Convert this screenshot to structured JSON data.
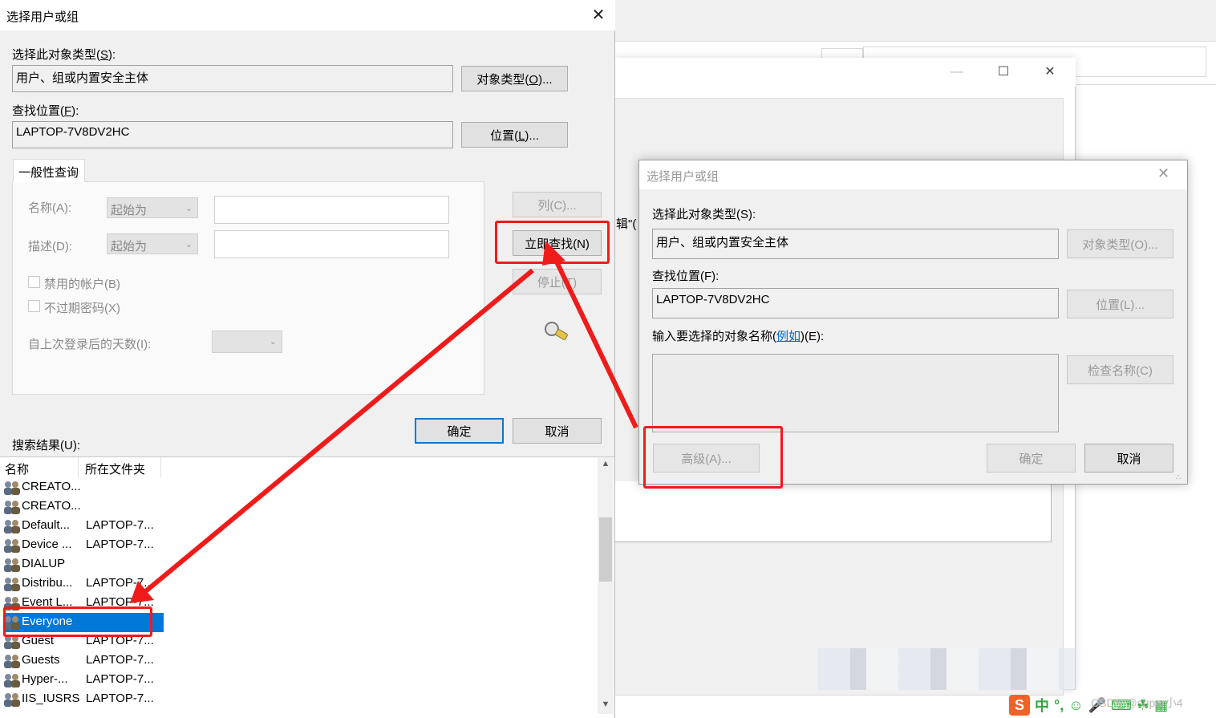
{
  "background_window": {
    "edit_fragment": "辑\"(",
    "minimize": "—",
    "maximize": "☐",
    "close": "✕"
  },
  "dialog_main": {
    "title": "选择用户或组",
    "close": "✕",
    "object_type_label": "选择此对象类型(",
    "object_type_key": "S",
    "object_type_suffix": "):",
    "object_type_value": "用户、组或内置安全主体",
    "object_types_button": "对象类型(",
    "object_types_key": "O",
    "object_types_suffix": ")...",
    "location_label": "查找位置(",
    "location_key": "F",
    "location_suffix": "):",
    "location_value": "LAPTOP-7V8DV2HC",
    "locations_button": "位置(",
    "locations_key": "L",
    "locations_suffix": ")...",
    "tab_label": "一般性查询",
    "name_label": "名称(A):",
    "name_mode": "起始为",
    "desc_label": "描述(D):",
    "desc_mode": "起始为",
    "disabled_accounts": "禁用的帐户(B)",
    "non_expiring_pw": "不过期密码(X)",
    "days_since_logon": "自上次登录后的天数(I):",
    "columns_button": "列(C)...",
    "find_now_button": "立即查找(N)",
    "stop_button": "停止(T)",
    "ok_button": "确定",
    "cancel_button": "取消",
    "results_label": "搜索结果(U):",
    "results_columns": [
      "名称",
      "所在文件夹"
    ],
    "results": [
      {
        "name": "CREATO...",
        "folder": ""
      },
      {
        "name": "CREATO...",
        "folder": ""
      },
      {
        "name": "Default...",
        "folder": "LAPTOP-7..."
      },
      {
        "name": "Device ...",
        "folder": "LAPTOP-7..."
      },
      {
        "name": "DIALUP",
        "folder": ""
      },
      {
        "name": "Distribu...",
        "folder": "LAPTOP-7..."
      },
      {
        "name": "Event L...",
        "folder": "LAPTOP-7..."
      },
      {
        "name": "Everyone",
        "folder": ""
      },
      {
        "name": "Guest",
        "folder": "LAPTOP-7..."
      },
      {
        "name": "Guests",
        "folder": "LAPTOP-7..."
      },
      {
        "name": "Hyper-...",
        "folder": "LAPTOP-7..."
      },
      {
        "name": "IIS_IUSRS",
        "folder": "LAPTOP-7..."
      }
    ],
    "selected_result": "Everyone"
  },
  "dialog_second": {
    "title": "选择用户或组",
    "close": "✕",
    "object_type_label": "选择此对象类型(S):",
    "object_type_value": "用户、组或内置安全主体",
    "object_types_button": "对象类型(O)...",
    "location_label": "查找位置(F):",
    "location_value": "LAPTOP-7V8DV2HC",
    "locations_button": "位置(L)...",
    "enter_names_label_pre": "输入要选择的对象名称(",
    "examples_link": "例如",
    "enter_names_label_post": ")(E):",
    "check_names_button": "检查名称(C)",
    "advanced_button": "高级(A)...",
    "ok_button": "确定",
    "cancel_button": "取消"
  },
  "taskbar": {
    "ime_logo": "S",
    "ime_mode": "中",
    "punct": "°,",
    "watermark": "CSDN @super小4"
  },
  "colors": {
    "highlight_red": "#ef1b1b",
    "selection_blue": "#0078d7",
    "dialog_bg": "#f0f0f0"
  }
}
